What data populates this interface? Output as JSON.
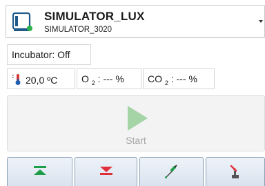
{
  "device": {
    "name": "SIMULATOR_LUX",
    "model": "SIMULATOR_3020"
  },
  "status": {
    "incubator": "Incubator: Off",
    "temperature": "20,0 ºC",
    "o2_prefix": "O ",
    "o2_sub": "2",
    "o2_suffix": " : --- %",
    "co2_prefix": "CO ",
    "co2_sub": "2",
    "co2_suffix": " : --- %"
  },
  "start_button": {
    "label": "Start"
  },
  "toolbar": {
    "buttons": [
      {
        "name": "move-top-button",
        "icon": "arrow-up-to-bar-icon"
      },
      {
        "name": "move-down-button",
        "icon": "arrow-down-to-bar-icon"
      },
      {
        "name": "pipette-button",
        "icon": "pipette-icon"
      },
      {
        "name": "eject-button",
        "icon": "eject-icon"
      }
    ]
  },
  "colors": {
    "green": "#1e9e46",
    "red": "#e0303a",
    "play_disabled": "#a5d4a7",
    "toolbar_border": "#8aa0b8"
  }
}
